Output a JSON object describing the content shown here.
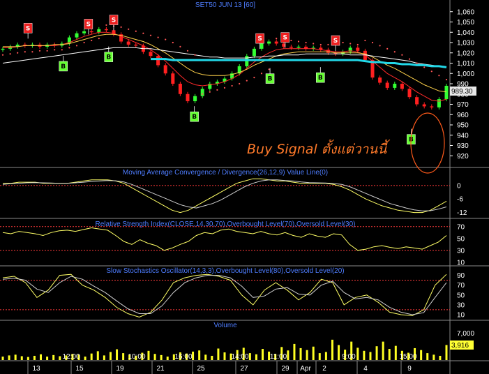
{
  "chart_data": [
    {
      "type": "line",
      "title": "SET50 JUN 13   [60]",
      "ylim": [
        910,
        1070
      ],
      "yticks": [
        1060,
        1050,
        1040,
        1030,
        1020,
        1010,
        1000,
        990,
        980,
        970,
        960,
        950,
        940,
        930,
        920
      ],
      "last_price_label": "989.30",
      "series": [
        {
          "role": "close",
          "color": "#ffffff",
          "values": [
            1024,
            1026,
            1028,
            1027,
            1028,
            1026,
            1028,
            1027,
            1029,
            1035,
            1039,
            1041,
            1040,
            1043,
            1042,
            1038,
            1031,
            1028,
            1027,
            1021,
            1017,
            1008,
            1000,
            990,
            980,
            973,
            978,
            985,
            990,
            992,
            995,
            1000,
            1007,
            1017,
            1024,
            1029,
            1031,
            1029,
            1026,
            1025,
            1026,
            1024,
            1025,
            1023,
            1020,
            1019,
            1021,
            1025,
            1022,
            1013,
            996,
            991,
            986,
            990,
            985,
            977,
            970,
            968,
            967,
            975,
            988
          ]
        },
        {
          "role": "moving-average",
          "color": "#ff2a2a",
          "values": [
            1025,
            1025,
            1026,
            1027,
            1027,
            1027,
            1027,
            1027,
            1028,
            1030,
            1033,
            1036,
            1038,
            1040,
            1040,
            1039,
            1036,
            1033,
            1030,
            1027,
            1023,
            1018,
            1012,
            1005,
            998,
            992,
            989,
            988,
            989,
            990,
            992,
            995,
            999,
            1005,
            1011,
            1016,
            1020,
            1023,
            1024,
            1024,
            1024,
            1024,
            1024,
            1023,
            1022,
            1021,
            1021,
            1022,
            1021,
            1018,
            1012,
            1006,
            1000,
            996,
            992,
            987,
            982,
            978,
            974,
            973,
            975
          ]
        },
        {
          "role": "moving-average",
          "color": "#ffd24a",
          "values": [
            1026,
            1026,
            1026,
            1027,
            1027,
            1027,
            1027,
            1028,
            1028,
            1029,
            1031,
            1033,
            1035,
            1037,
            1038,
            1038,
            1037,
            1035,
            1033,
            1031,
            1028,
            1024,
            1020,
            1015,
            1010,
            1005,
            1001,
            999,
            998,
            998,
            998,
            999,
            1001,
            1004,
            1008,
            1011,
            1014,
            1017,
            1019,
            1020,
            1021,
            1021,
            1021,
            1021,
            1021,
            1020,
            1020,
            1020,
            1020,
            1019,
            1016,
            1012,
            1008,
            1005,
            1001,
            997,
            993,
            989,
            986,
            983,
            982
          ]
        },
        {
          "role": "moving-average",
          "color": "#ffffff",
          "values": [
            1010,
            1011,
            1012,
            1013,
            1014,
            1015,
            1016,
            1017,
            1018,
            1019,
            1020,
            1021,
            1022,
            1023,
            1024,
            1025,
            1025,
            1025,
            1025,
            1024,
            1024,
            1023,
            1022,
            1021,
            1020,
            1019,
            1018,
            1017,
            1016,
            1016,
            1015,
            1015,
            1015,
            1015,
            1016,
            1016,
            1017,
            1017,
            1018,
            1018,
            1018,
            1019,
            1019,
            1019,
            1019,
            1019,
            1019,
            1018,
            1018,
            1018,
            1017,
            1016,
            1015,
            1014,
            1013,
            1012,
            1010,
            1009,
            1008,
            1007,
            1006
          ]
        },
        {
          "role": "moving-average",
          "color": "#22d8e8",
          "values": [
            null,
            null,
            null,
            null,
            null,
            null,
            null,
            null,
            null,
            null,
            null,
            null,
            null,
            null,
            null,
            null,
            null,
            null,
            null,
            null,
            1014,
            1014,
            1014,
            1013,
            1013,
            1013,
            1013,
            1013,
            1013,
            1013,
            1013,
            1013,
            1013,
            1013,
            1013,
            1013,
            1013,
            1013,
            1013,
            1013,
            1013,
            1013,
            1013,
            1013,
            1013,
            1013,
            1013,
            1013,
            1013,
            1012,
            1011,
            1011,
            1010,
            1010,
            1009,
            1009,
            1008,
            1008,
            1007,
            1007,
            1006
          ]
        },
        {
          "role": "sar",
          "color": "#ff5555",
          "values": [
            1018,
            1019,
            1020,
            1021,
            1021,
            1022,
            1022,
            1023,
            1023,
            1025,
            1027,
            1030,
            1032,
            1034,
            1047,
            1046,
            1045,
            1043,
            1041,
            1039,
            1037,
            1035,
            1033,
            1030,
            1026,
            1022,
            1018,
            980,
            982,
            984,
            986,
            988,
            990,
            993,
            996,
            1000,
            1004,
            1034,
            1033,
            1032,
            1031,
            1030,
            1029,
            1028,
            1028,
            1031,
            1030,
            1029,
            1028,
            1032,
            1030,
            1027,
            1024,
            1021,
            1018,
            1014,
            1010,
            1006,
            1002,
            998,
            994
          ]
        }
      ],
      "signals": [
        {
          "type": "S",
          "x": 5,
          "y": 1044
        },
        {
          "type": "B",
          "x": 12,
          "y": 1007
        },
        {
          "type": "S",
          "x": 17,
          "y": 1048
        },
        {
          "type": "S",
          "x": 22,
          "y": 1052
        },
        {
          "type": "B",
          "x": 21,
          "y": 1016
        },
        {
          "type": "B",
          "x": 38,
          "y": 958
        },
        {
          "type": "S",
          "x": 51,
          "y": 1034
        },
        {
          "type": "S",
          "x": 56,
          "y": 1035
        },
        {
          "type": "B",
          "x": 53,
          "y": 995
        },
        {
          "type": "B",
          "x": 63,
          "y": 996
        },
        {
          "type": "S",
          "x": 66,
          "y": 1032
        },
        {
          "type": "B",
          "x": 81,
          "y": 936
        }
      ],
      "annotation": "Buy Signal ตั้งแต่วานนี้"
    },
    {
      "type": "line",
      "title": "Moving Average Convergence / Divergence(26,12,9) Value Line(0)",
      "ylim": [
        -14,
        4
      ],
      "yticks": [
        0,
        -6,
        -12
      ],
      "series": [
        {
          "role": "macd",
          "color": "#ffff66",
          "values": [
            1,
            1,
            1.5,
            1.5,
            1.5,
            1,
            1,
            1,
            1,
            1.5,
            2,
            2.5,
            2.5,
            2.5,
            2,
            1,
            -1,
            -3,
            -5,
            -7,
            -9,
            -11,
            -12,
            -11,
            -9,
            -7,
            -5,
            -3,
            -1,
            1,
            2,
            3,
            3,
            2.5,
            2,
            2,
            1.5,
            1,
            1,
            1,
            1,
            0.5,
            -0.5,
            -2,
            -4,
            -6,
            -7.5,
            -9,
            -10,
            -11,
            -11.5,
            -12,
            -12,
            -11,
            -9,
            -7
          ]
        },
        {
          "role": "signal",
          "color": "#d0d0d0",
          "values": [
            0.5,
            0.8,
            1,
            1.2,
            1.3,
            1.2,
            1.1,
            1,
            1,
            1.2,
            1.5,
            1.8,
            2,
            2.2,
            2.1,
            1.6,
            0.5,
            -1,
            -2.5,
            -4,
            -5.5,
            -7,
            -8.5,
            -9.5,
            -10,
            -9,
            -8,
            -6.5,
            -4.5,
            -2.5,
            -0.5,
            1,
            2,
            2.5,
            2.5,
            2.2,
            2,
            1.6,
            1.3,
            1.2,
            1.1,
            0.9,
            0.5,
            -0.5,
            -2,
            -3.5,
            -5,
            -6.5,
            -8,
            -9,
            -10,
            -10.8,
            -11.3,
            -11.2,
            -10.5,
            -9.5
          ]
        }
      ],
      "value_line": 0
    },
    {
      "type": "line",
      "title": "Relative Strength Index(CLOSE,14,30,70),Overbought Level(70),Oversold Level(30)",
      "ylim": [
        5,
        78
      ],
      "yticks": [
        70,
        50,
        30,
        10
      ],
      "levels": [
        70,
        30
      ],
      "series": [
        {
          "role": "rsi",
          "color": "#ffff66",
          "values": [
            60,
            58,
            62,
            60,
            58,
            55,
            60,
            63,
            64,
            62,
            65,
            68,
            66,
            64,
            55,
            45,
            40,
            48,
            42,
            38,
            30,
            34,
            40,
            45,
            55,
            60,
            58,
            64,
            66,
            62,
            60,
            58,
            62,
            58,
            56,
            60,
            55,
            52,
            58,
            54,
            52,
            58,
            56,
            40,
            30,
            32,
            36,
            38,
            35,
            33,
            36,
            34,
            32,
            38,
            44,
            55
          ]
        }
      ]
    },
    {
      "type": "line",
      "title": "Slow Stochastics Oscillator(14,3,3),Overbought Level(80),Oversold Level(20)",
      "ylim": [
        0,
        105
      ],
      "yticks": [
        90,
        70,
        50,
        30,
        10
      ],
      "levels": [
        80,
        20
      ],
      "series": [
        {
          "role": "k",
          "color": "#ffff66",
          "values": [
            85,
            88,
            75,
            45,
            60,
            90,
            92,
            70,
            60,
            45,
            25,
            12,
            5,
            15,
            40,
            75,
            85,
            90,
            92,
            88,
            80,
            50,
            30,
            60,
            75,
            60,
            40,
            55,
            82,
            75,
            30,
            45,
            50,
            35,
            15,
            10,
            8,
            20,
            70,
            92
          ]
        },
        {
          "role": "d",
          "color": "#d0d0d0",
          "values": [
            82,
            84,
            80,
            62,
            55,
            75,
            88,
            82,
            68,
            55,
            38,
            22,
            12,
            12,
            28,
            55,
            75,
            85,
            90,
            90,
            85,
            68,
            45,
            48,
            62,
            65,
            52,
            50,
            70,
            78,
            55,
            42,
            45,
            40,
            25,
            15,
            10,
            14,
            45,
            75
          ]
        }
      ]
    },
    {
      "type": "bar",
      "title": "Volume",
      "ylim": [
        0,
        10000
      ],
      "yticks": [
        7000
      ],
      "last_value_label": "3,916",
      "values": [
        900,
        1200,
        1400,
        1000,
        800,
        1100,
        1500,
        900,
        1300,
        1000,
        1200,
        1600,
        1400,
        900,
        1700,
        2300,
        1200,
        2100,
        2800,
        1800,
        1400,
        1100,
        1900,
        2400,
        1600,
        1300,
        900,
        1500,
        2000,
        1700,
        2200,
        2500,
        1400,
        1100,
        3000,
        2000,
        1700,
        2600,
        3200,
        1800,
        1500,
        2900,
        2200,
        1600,
        3400,
        2500,
        4200,
        3100,
        2600,
        3500,
        1800,
        2100,
        5300,
        3900,
        2700,
        4800,
        3200,
        2400,
        2100,
        3600,
        4800,
        2900,
        3700,
        2400,
        1900,
        3100,
        2600,
        1800,
        1400,
        1100,
        3916
      ]
    }
  ],
  "x_axis": {
    "time_labels": [
      "12:00",
      "10:00",
      "16:00",
      "14:00",
      "11:00",
      "9:00",
      "15:00"
    ],
    "date_labels": [
      "13",
      "15",
      "19",
      "21",
      "25",
      "27",
      "29",
      "Apr",
      "2",
      "4",
      "9"
    ]
  }
}
